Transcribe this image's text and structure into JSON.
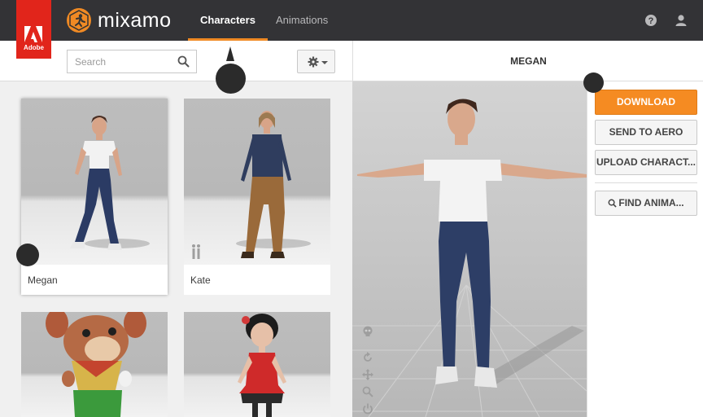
{
  "brand": {
    "adobe_label": "Adobe",
    "app_name": "mixamo",
    "accent_color": "#f08a24",
    "adobe_red": "#e1251b"
  },
  "nav": {
    "tabs": [
      {
        "label": "Characters",
        "active": true
      },
      {
        "label": "Animations",
        "active": false
      }
    ]
  },
  "header_icons": [
    "help-icon",
    "user-icon"
  ],
  "search": {
    "placeholder": "Search",
    "value": ""
  },
  "characters": [
    {
      "name": "Megan",
      "selected": true
    },
    {
      "name": "Kate",
      "selected": false
    },
    {
      "name": "",
      "selected": false
    },
    {
      "name": "",
      "selected": false
    }
  ],
  "viewer": {
    "title": "MEGAN"
  },
  "actions": {
    "download": "DOWNLOAD",
    "send_to_aero": "SEND TO AERO",
    "upload_character": "UPLOAD CHARACT...",
    "find_animations": "FIND ANIMA..."
  }
}
